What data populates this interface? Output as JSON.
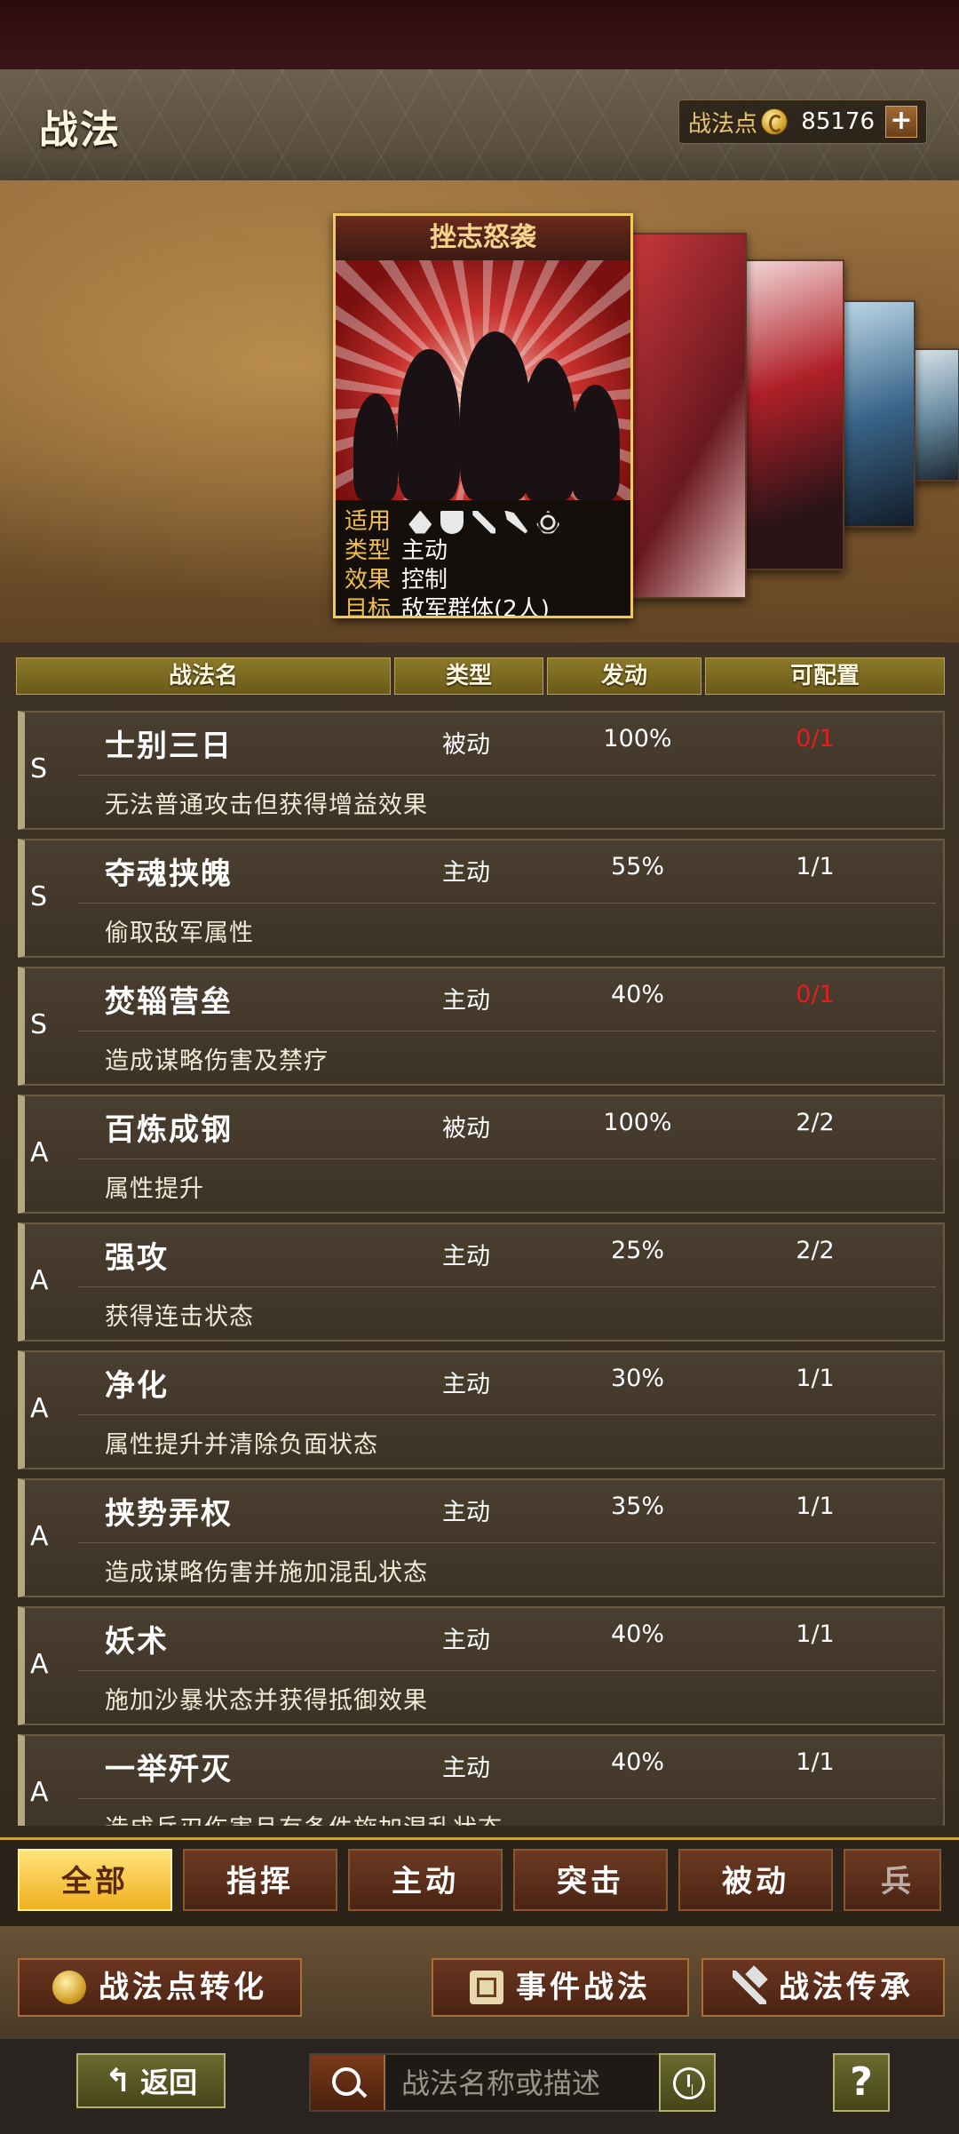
{
  "header": {
    "title": "战法",
    "points_label": "战法点",
    "points_value": "85176",
    "plus_label": "+"
  },
  "featured_card": {
    "title": "挫志怒袭",
    "fields": [
      {
        "key": "适用",
        "value": ""
      },
      {
        "key": "类型",
        "value": "主动"
      },
      {
        "key": "效果",
        "value": "控制"
      },
      {
        "key": "目标",
        "value": "敌军群体(2人)"
      }
    ],
    "troop_icons": [
      "cavalry-icon",
      "shield-icon",
      "bow-icon",
      "spear-icon",
      "wheel-icon"
    ]
  },
  "columns": [
    "战法名",
    "类型",
    "发动",
    "可配置"
  ],
  "skills": [
    {
      "grade": "S",
      "name": "士别三日",
      "type": "被动",
      "rate": "100%",
      "count": "0/1",
      "count_red": true,
      "desc": "无法普通攻击但获得增益效果"
    },
    {
      "grade": "S",
      "name": "夺魂挟魄",
      "type": "主动",
      "rate": "55%",
      "count": "1/1",
      "count_red": false,
      "desc": "偷取敌军属性"
    },
    {
      "grade": "S",
      "name": "焚辎营垒",
      "type": "主动",
      "rate": "40%",
      "count": "0/1",
      "count_red": true,
      "desc": "造成谋略伤害及禁疗"
    },
    {
      "grade": "A",
      "name": "百炼成钢",
      "type": "被动",
      "rate": "100%",
      "count": "2/2",
      "count_red": false,
      "desc": "属性提升"
    },
    {
      "grade": "A",
      "name": "强攻",
      "type": "主动",
      "rate": "25%",
      "count": "2/2",
      "count_red": false,
      "desc": "获得连击状态"
    },
    {
      "grade": "A",
      "name": "净化",
      "type": "主动",
      "rate": "30%",
      "count": "1/1",
      "count_red": false,
      "desc": "属性提升并清除负面状态"
    },
    {
      "grade": "A",
      "name": "挟势弄权",
      "type": "主动",
      "rate": "35%",
      "count": "1/1",
      "count_red": false,
      "desc": "造成谋略伤害并施加混乱状态"
    },
    {
      "grade": "A",
      "name": "妖术",
      "type": "主动",
      "rate": "40%",
      "count": "1/1",
      "count_red": false,
      "desc": "施加沙暴状态并获得抵御效果"
    },
    {
      "grade": "A",
      "name": "一举歼灭",
      "type": "主动",
      "rate": "40%",
      "count": "1/1",
      "count_red": false,
      "desc": "造成兵刃伤害且有条件施加混乱状态"
    }
  ],
  "tabs": [
    "全部",
    "指挥",
    "主动",
    "突击",
    "被动",
    "兵种"
  ],
  "actions": {
    "convert": "战法点转化",
    "event": "事件战法",
    "inherit": "战法传承"
  },
  "bottom": {
    "back": "返回",
    "search_placeholder": "战法名称或描述",
    "help": "?"
  },
  "colors": {
    "accent_gold": "#f0b020",
    "red_count": "#e02020"
  }
}
